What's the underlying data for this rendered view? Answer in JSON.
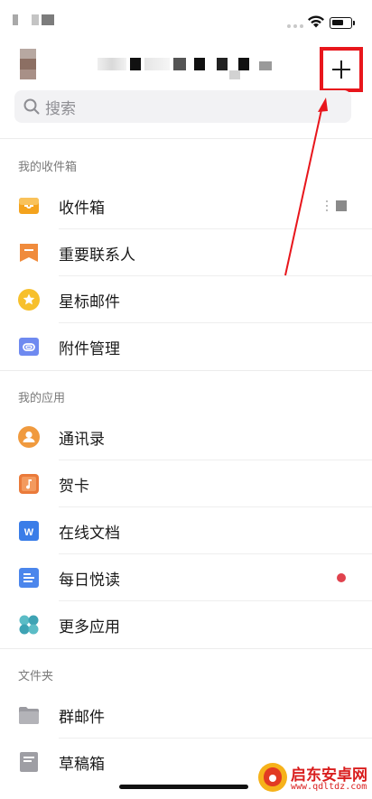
{
  "header": {
    "add_glyph": "+"
  },
  "search": {
    "placeholder": "搜索"
  },
  "sections": [
    {
      "title": "我的收件箱",
      "items": [
        {
          "label": "收件箱",
          "icon": "inbox-tray-icon"
        },
        {
          "label": "重要联系人",
          "icon": "bookmark-icon"
        },
        {
          "label": "星标邮件",
          "icon": "star-icon"
        },
        {
          "label": "附件管理",
          "icon": "paperclip-icon"
        }
      ]
    },
    {
      "title": "我的应用",
      "items": [
        {
          "label": "通讯录",
          "icon": "contacts-icon"
        },
        {
          "label": "贺卡",
          "icon": "music-card-icon"
        },
        {
          "label": "在线文档",
          "icon": "word-document-icon"
        },
        {
          "label": "每日悦读",
          "icon": "reading-icon"
        },
        {
          "label": "更多应用",
          "icon": "more-apps-icon"
        }
      ]
    },
    {
      "title": "文件夹",
      "items": [
        {
          "label": "群邮件",
          "icon": "folder-icon"
        },
        {
          "label": "草稿箱",
          "icon": "draft-icon"
        }
      ]
    }
  ],
  "watermark": {
    "text": "启东安卓网",
    "url": "www.qdltdz.com"
  },
  "colors": {
    "accent_red": "#e8161c",
    "badge_red": "#e0424d",
    "inbox_orange": "#f4a31d",
    "bookmark_orange": "#f08b3c",
    "star_yellow": "#f7c02c",
    "attach_blue": "#6f8af0",
    "word_blue": "#3a7de8"
  }
}
